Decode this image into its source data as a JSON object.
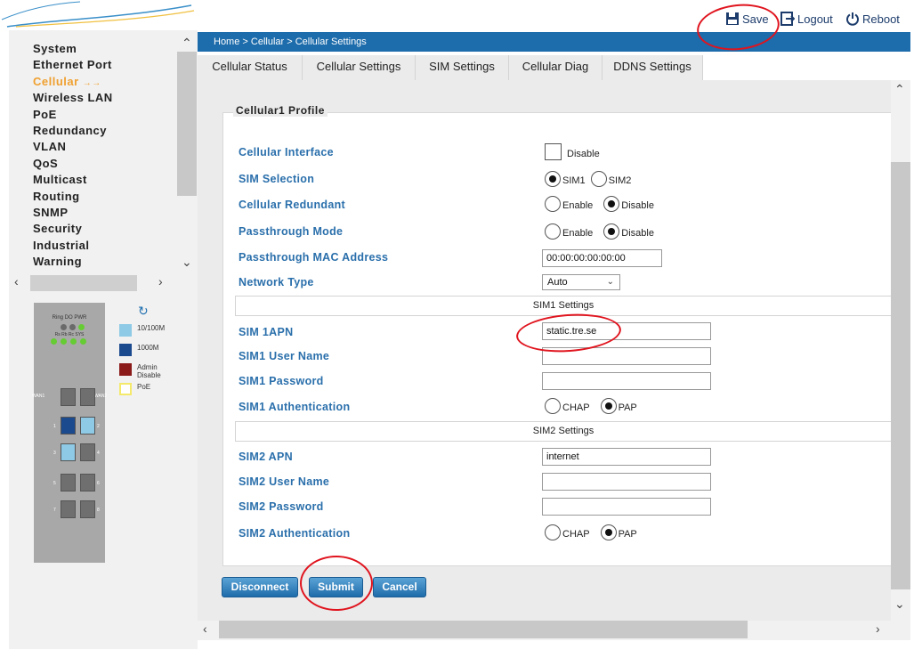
{
  "header": {
    "save_label": "Save",
    "logout_label": "Logout",
    "reboot_label": "Reboot"
  },
  "sidebar": {
    "items": [
      {
        "label": "System"
      },
      {
        "label": "Ethernet Port"
      },
      {
        "label": "Cellular",
        "active": true,
        "marker": "→→"
      },
      {
        "label": "Wireless LAN"
      },
      {
        "label": "PoE"
      },
      {
        "label": "Redundancy"
      },
      {
        "label": "VLAN"
      },
      {
        "label": "QoS"
      },
      {
        "label": "Multicast"
      },
      {
        "label": "Routing"
      },
      {
        "label": "SNMP"
      },
      {
        "label": "Security"
      },
      {
        "label": "Industrial"
      },
      {
        "label": "Warning"
      }
    ]
  },
  "device": {
    "top_label": "Ring DO PWR",
    "led_label": "Rs Rb Rc SYS",
    "wan1": "WAN1",
    "wan2": "WAN2",
    "ports": [
      "1",
      "2",
      "3",
      "4",
      "5",
      "6",
      "7",
      "8"
    ]
  },
  "legend": {
    "p100": "10/100M",
    "p1000": "1000M",
    "admin": "Admin Disable",
    "poe": "PoE",
    "colors": {
      "p100": "#8ecae6",
      "p1000": "#1c4a8e",
      "admin": "#8b1a1a",
      "poe": "#f5e96b"
    }
  },
  "breadcrumb": "Home  >  Cellular  >  Cellular Settings",
  "tabs": [
    {
      "label": "Cellular Status"
    },
    {
      "label": "Cellular Settings",
      "active": true
    },
    {
      "label": "SIM Settings"
    },
    {
      "label": "Cellular Diag"
    },
    {
      "label": "DDNS Settings"
    }
  ],
  "form": {
    "title": "Cellular1 Profile",
    "cellular_interface": {
      "label": "Cellular Interface",
      "option": "Disable",
      "checked": false
    },
    "sim_selection": {
      "label": "SIM Selection",
      "options": [
        "SIM1",
        "SIM2"
      ],
      "selected": "SIM1"
    },
    "cellular_redundant": {
      "label": "Cellular Redundant",
      "options": [
        "Enable",
        "Disable"
      ],
      "selected": "Disable"
    },
    "passthrough_mode": {
      "label": "Passthrough Mode",
      "options": [
        "Enable",
        "Disable"
      ],
      "selected": "Disable"
    },
    "passthrough_mac": {
      "label": "Passthrough MAC Address",
      "value": "00:00:00:00:00:00"
    },
    "network_type": {
      "label": "Network Type",
      "value": "Auto"
    },
    "sim1_section": "SIM1 Settings",
    "sim1_apn": {
      "label": "SIM 1APN",
      "value": "static.tre.se"
    },
    "sim1_user": {
      "label": "SIM1 User Name",
      "value": ""
    },
    "sim1_password": {
      "label": "SIM1 Password",
      "value": ""
    },
    "sim1_auth": {
      "label": "SIM1 Authentication",
      "options": [
        "CHAP",
        "PAP"
      ],
      "selected": "PAP"
    },
    "sim2_section": "SIM2 Settings",
    "sim2_apn": {
      "label": "SIM2 APN",
      "value": "internet"
    },
    "sim2_user": {
      "label": "SIM2 User Name",
      "value": ""
    },
    "sim2_password": {
      "label": "SIM2 Password",
      "value": ""
    },
    "sim2_auth": {
      "label": "SIM2 Authentication",
      "options": [
        "CHAP",
        "PAP"
      ],
      "selected": "PAP"
    }
  },
  "buttons": {
    "disconnect": "Disconnect",
    "submit": "Submit",
    "cancel": "Cancel"
  },
  "colors": {
    "accent": "#1d6cab",
    "label_blue": "#2a6fab",
    "annotation_red": "#e0141e",
    "active_menu": "#f0a030"
  }
}
